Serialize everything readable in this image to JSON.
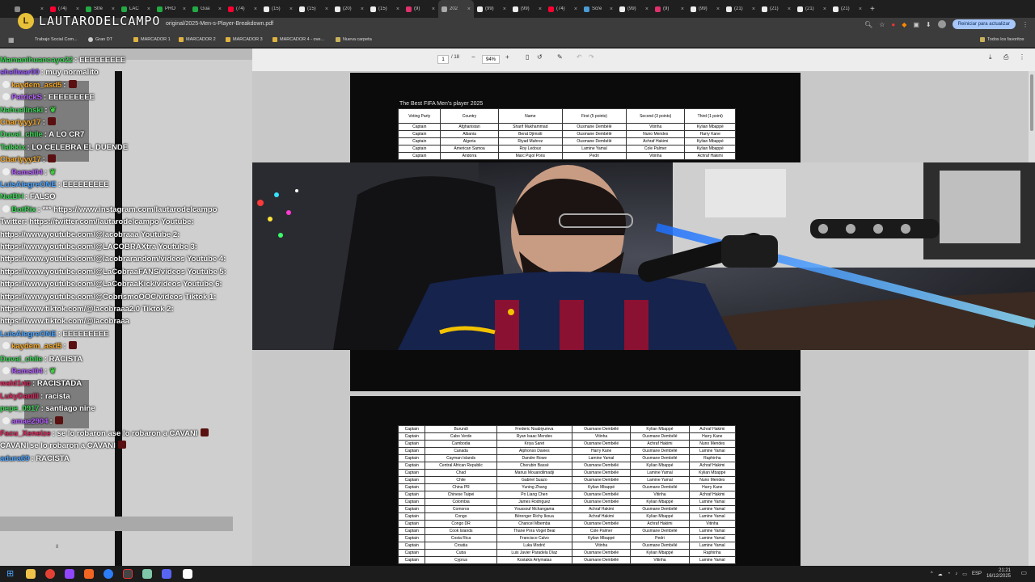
{
  "browser": {
    "tabs": [
      {
        "label": "",
        "color": "#888888"
      },
      {
        "label": "(74)",
        "color": "#ff0033"
      },
      {
        "label": "Stre",
        "color": "#22aa44"
      },
      {
        "label": "LAC",
        "color": "#22aa44"
      },
      {
        "label": "PRO",
        "color": "#22aa44"
      },
      {
        "label": "Gua",
        "color": "#22aa44"
      },
      {
        "label": "(74)",
        "color": "#ff0033"
      },
      {
        "label": "(15)",
        "color": "#eeeeee"
      },
      {
        "label": "(15)",
        "color": "#eeeeee"
      },
      {
        "label": "(20)",
        "color": "#eeeeee"
      },
      {
        "label": "(15)",
        "color": "#eeeeee"
      },
      {
        "label": "(9)",
        "color": "#e1306c"
      },
      {
        "label": "202",
        "color": "#aaaaaa"
      },
      {
        "label": "(99)",
        "color": "#eeeeee"
      },
      {
        "label": "(99)",
        "color": "#eeeeee"
      },
      {
        "label": "(74)",
        "color": "#ff0033"
      },
      {
        "label": "Scre",
        "color": "#4a9bd6"
      },
      {
        "label": "(99)",
        "color": "#eeeeee"
      },
      {
        "label": "(9)",
        "color": "#e1306c"
      },
      {
        "label": "(99)",
        "color": "#eeeeee"
      },
      {
        "label": "(21)",
        "color": "#eeeeee"
      },
      {
        "label": "(21)",
        "color": "#eeeeee"
      },
      {
        "label": "(21)",
        "color": "#eeeeee"
      },
      {
        "label": "(21)",
        "color": "#eeeeee"
      }
    ],
    "active_tab_index": 12,
    "url": "original/2025-Men-s-Player-Breakdown.pdf",
    "update_button": "Reiniciar para actualizar",
    "bookmarks": [
      "Trabajo Social Com...",
      "Gran DT",
      "MARCADOR 1",
      "MARCADOR 2",
      "MARCADOR 3",
      "MARCADOR 4 - ove...",
      "Nueva carpeta"
    ],
    "all_bookmarks": "Todos los favoritos"
  },
  "overlay": {
    "logo_text": "LAUTARODELCAMPO",
    "logo_mark": "L"
  },
  "pdf": {
    "page_current": "1",
    "page_total": "/ 18",
    "zoom": "94%",
    "title": "The Best FIFA Men's player 2025",
    "headers": [
      "Voting Party",
      "Country",
      "Name",
      "First (5 points)",
      "Second (3 points)",
      "Third (1 point)"
    ],
    "rows_page1": [
      [
        "Captain",
        "Afghanistan",
        "Sharif Mukhammad",
        "Ousmane Dembélé",
        "Vitinha",
        "Kylian Mbappé"
      ],
      [
        "Captain",
        "Albania",
        "Berat Djimsiti",
        "Ousmane Dembélé",
        "Nuno Mendes",
        "Harry Kane"
      ],
      [
        "Captain",
        "Algeria",
        "Riyad Mahrez",
        "Ousmane Dembélé",
        "Achraf Hakimi",
        "Kylian Mbappé"
      ],
      [
        "Captain",
        "American Samoa",
        "Roy Ledoux",
        "Lamine Yamal",
        "Cole Palmer",
        "Kylian Mbappé"
      ],
      [
        "Captain",
        "Andorra",
        "Marc Pujol Pons",
        "Pedri",
        "Vitinha",
        "Achraf Hakimi"
      ]
    ],
    "rows_page2": [
      [
        "Captain",
        "Burundi",
        "Frederic Nsabiyumva",
        "Ousmane Dembélé",
        "Kylian Mbappé",
        "Achraf Hakimi"
      ],
      [
        "Captain",
        "Cabo Verde",
        "Ryan Isaac Mendes",
        "Vitinha",
        "Ousmane Dembélé",
        "Harry Kane"
      ],
      [
        "Captain",
        "Cambodia",
        "Kriya Saret",
        "Ousmane Dembélé",
        "Achraf Hakimi",
        "Nuno Mendes"
      ],
      [
        "Captain",
        "Canada",
        "Alphonso Davies",
        "Harry Kane",
        "Ousmane Dembélé",
        "Lamine Yamal"
      ],
      [
        "Captain",
        "Cayman Islands",
        "Dandre Rowe",
        "Lamine Yamal",
        "Ousmane Dembélé",
        "Raphinha"
      ],
      [
        "Captain",
        "Central African Republic",
        "Cherubin Bassé",
        "Ousmane Dembélé",
        "Kylian Mbappé",
        "Achraf Hakimi"
      ],
      [
        "Captain",
        "Chad",
        "Marius Mouandilmadji",
        "Ousmane Dembélé",
        "Lamine Yamal",
        "Kylian Mbappé"
      ],
      [
        "Captain",
        "Chile",
        "Gabriel Suazo",
        "Ousmane Dembélé",
        "Lamine Yamal",
        "Nuno Mendes"
      ],
      [
        "Captain",
        "China PR",
        "Yuning Zhang",
        "Kylian Mbappé",
        "Ousmane Dembélé",
        "Harry Kane"
      ],
      [
        "Captain",
        "Chinese Taipei",
        "Po Liang Chen",
        "Ousmane Dembélé",
        "Vitinha",
        "Achraf Hakimi"
      ],
      [
        "Captain",
        "Colombia",
        "James Rodríguez",
        "Ousmane Dembélé",
        "Kylian Mbappé",
        "Lamine Yamal"
      ],
      [
        "Captain",
        "Comoros",
        "Youssouf Mchangama",
        "Achraf Hakimi",
        "Ousmane Dembélé",
        "Lamine Yamal"
      ],
      [
        "Captain",
        "Congo",
        "Bérenger Richy Ikoua",
        "Achraf Hakimi",
        "Kylian Mbappé",
        "Lamine Yamal"
      ],
      [
        "Captain",
        "Congo DR",
        "Chancel Mbemba",
        "Ousmane Dembélé",
        "Achraf Hakimi",
        "Vitinha"
      ],
      [
        "Captain",
        "Cook Islands",
        "Thane Pora Vogel Beal",
        "Cole Palmer",
        "Ousmane Dembélé",
        "Lamine Yamal"
      ],
      [
        "Captain",
        "Costa Rica",
        "Francisco Calvo",
        "Kylian Mbappé",
        "Pedri",
        "Lamine Yamal"
      ],
      [
        "Captain",
        "Croatia",
        "Luka Modrić",
        "Vitinha",
        "Ousmane Dembélé",
        "Lamine Yamal"
      ],
      [
        "Captain",
        "Cuba",
        "Luis Javier Paradela Díaz",
        "Ousmane Dembélé",
        "Kylian Mbappé",
        "Raphinha"
      ],
      [
        "Captain",
        "Cyprus",
        "Kostakis Artymatas",
        "Ousmane Dembélé",
        "Vitinha",
        "Lamine Yamal"
      ]
    ]
  },
  "chat": {
    "messages": [
      {
        "user": "Mamanihuancayo22",
        "text": ": EEEEEEEEE",
        "color": "#39d353"
      },
      {
        "user": "shellwar00",
        "text": ": muy normalito",
        "color": "#9a56ff"
      },
      {
        "user": "kaydem_asd5",
        "text": ":",
        "color": "#f5a623",
        "badge": true,
        "emote": true
      },
      {
        "user": "PatrickS",
        "text": ": EEEEEEEEE",
        "color": "#b45cff",
        "badge": true
      },
      {
        "user": "Nahuelinski",
        "text": ":",
        "color": "#39d353",
        "leaf": true
      },
      {
        "user": "Charlyyy17",
        "text": ":",
        "color": "#f5a623",
        "emote": true
      },
      {
        "user": "Duvai_chile",
        "text": ": A LO CR7",
        "color": "#39d353"
      },
      {
        "user": "Taikkix",
        "text": ": LO CELEBRA EL DUENDE",
        "color": "#39d353"
      },
      {
        "user": "Charlyyy17",
        "text": ":",
        "color": "#f5a623",
        "emote": true
      },
      {
        "user": "Ramsi04",
        "text": ":",
        "color": "#b45cff",
        "badge": true,
        "leaf": true
      },
      {
        "user": "LuisAlegreONE",
        "text": ": EEEEEEEEE",
        "color": "#4aa3ff"
      },
      {
        "user": "NatBH",
        "text": ": FALSO",
        "color": "#39d353"
      },
      {
        "user": "BotRix",
        "text": ": *** https://www.instagram.com/lautarodelcampo",
        "color": "#39d353",
        "badge": true
      },
      {
        "user": "",
        "text": "Twitter: https://twitter.com/lautarodelcampo Youtube:",
        "color": "#ffffff"
      },
      {
        "user": "",
        "text": "https://www.youtube.com/@lacobraaa Youtube 2:",
        "color": "#ffffff"
      },
      {
        "user": "",
        "text": "https://www.youtube.com/@LACOBRAXtra Youtube 3:",
        "color": "#ffffff"
      },
      {
        "user": "",
        "text": "https://www.youtube.com/@lacobrarandom/videos Youtube 4:",
        "color": "#ffffff"
      },
      {
        "user": "",
        "text": "https://www.youtube.com/@LaCobraaFANS/videos Youtube 5:",
        "color": "#ffffff"
      },
      {
        "user": "",
        "text": "https://www.youtube.com/@LaCobraaKick/videos Youtube 6:",
        "color": "#ffffff"
      },
      {
        "user": "",
        "text": "https://www.youtube.com/@CobrismoOOC/videos Tiktok 1:",
        "color": "#ffffff"
      },
      {
        "user": "",
        "text": "https://www.tiktok.com/@lacobraaa2.0 Tiktok 2:",
        "color": "#ffffff"
      },
      {
        "user": "",
        "text": "https://www.tiktok.com/@lacobraaa",
        "color": "#ffffff"
      },
      {
        "user": "LuisAlegreONE",
        "text": ": EEEEEEEEE",
        "color": "#4aa3ff"
      },
      {
        "user": "kaydem_asd5",
        "text": ":",
        "color": "#f5a623",
        "badge": true,
        "emote": true
      },
      {
        "user": "Duvai_chile",
        "text": ": RACISTA",
        "color": "#39d353"
      },
      {
        "user": "Ramsi04",
        "text": ":",
        "color": "#b45cff",
        "badge": true,
        "leaf": true
      },
      {
        "user": "wald1no",
        "text": ": RACISTADA",
        "color": "#e0245e"
      },
      {
        "user": "LukyDanill",
        "text": ": racista",
        "color": "#e0245e"
      },
      {
        "user": "pepe_0917",
        "text": ": santiago nine",
        "color": "#39d353"
      },
      {
        "user": "amae2904",
        "text": ":",
        "color": "#b45cff",
        "badge": true,
        "emote": true
      },
      {
        "user": "Facu_Xeneize",
        "text": ": se lo robaron ase lo robaron a CAVANI",
        "color": "#e0245e",
        "emote": true
      },
      {
        "user": "CAVANI",
        "text": "se lo robaron a CAVANI",
        "color": "#ffffff",
        "emote": true
      },
      {
        "user": "adura69",
        "text": ": RACISTA",
        "color": "#4aa3ff"
      }
    ],
    "page_marker": "8"
  },
  "taskbar": {
    "lang": "ESP",
    "time": "21:21",
    "date": "16/12/2025"
  }
}
